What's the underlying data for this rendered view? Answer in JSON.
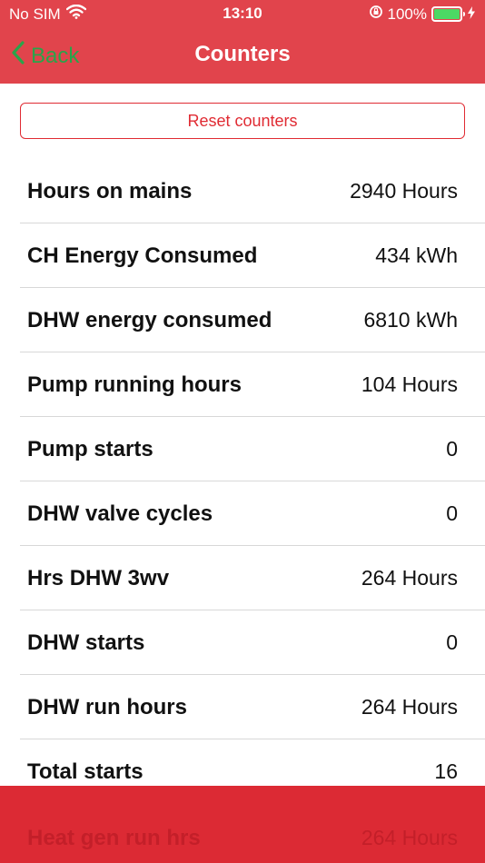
{
  "status_bar": {
    "carrier": "No SIM",
    "time": "13:10",
    "battery_percent": "100%",
    "battery_level": 1.0,
    "icons": [
      "wifi-icon",
      "orientation-lock-icon",
      "battery-icon",
      "charging-bolt-icon"
    ]
  },
  "nav": {
    "back_label": "Back",
    "title": "Counters"
  },
  "actions": {
    "reset_label": "Reset counters"
  },
  "counters": [
    {
      "label": "Hours on mains",
      "value": "2940 Hours"
    },
    {
      "label": "CH Energy Consumed",
      "value": "434 kWh"
    },
    {
      "label": "DHW energy consumed",
      "value": "6810 kWh"
    },
    {
      "label": "Pump running hours",
      "value": "104 Hours"
    },
    {
      "label": "Pump starts",
      "value": "0"
    },
    {
      "label": "DHW valve cycles",
      "value": "0"
    },
    {
      "label": "Hrs DHW 3wv",
      "value": "264 Hours"
    },
    {
      "label": "DHW starts",
      "value": "0"
    },
    {
      "label": "DHW run hours",
      "value": "264 Hours"
    },
    {
      "label": "Total starts",
      "value": "16"
    }
  ],
  "partially_hidden_row": {
    "label": "Heat gen run hrs",
    "value": "264 Hours"
  },
  "colors": {
    "header_red": "#e1444c",
    "bottom_red": "#dc2a34",
    "back_green": "#2aa44a",
    "reset_red": "#e02b33"
  }
}
